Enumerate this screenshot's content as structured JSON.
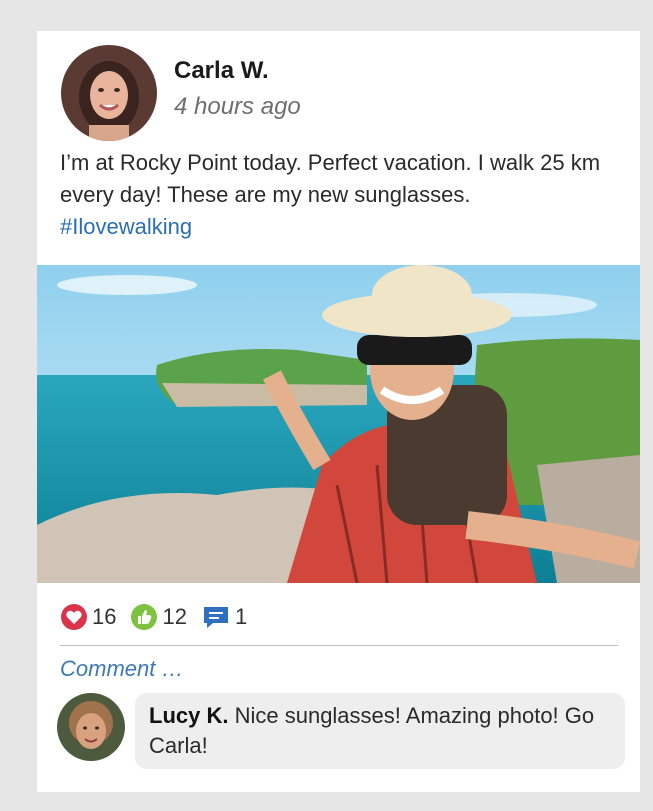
{
  "post": {
    "author": "Carla W.",
    "time": "4 hours ago",
    "text": "I’m at Rocky Point today. Perfect vacation. I walk 25 km every day! These are my new sunglasses.",
    "hashtag": "#Ilovewalking"
  },
  "reactions": [
    {
      "icon": "heart-icon",
      "count": "16",
      "color": "#d9344a"
    },
    {
      "icon": "thumbs-up-icon",
      "count": "12",
      "color": "#7fc241"
    },
    {
      "icon": "comment-icon",
      "count": "1",
      "color": "#2f6fc0"
    }
  ],
  "comment_placeholder": "Comment …",
  "comment": {
    "author": "Lucy K.",
    "text": "Nice sunglasses! Amazing photo! Go Carla!"
  }
}
